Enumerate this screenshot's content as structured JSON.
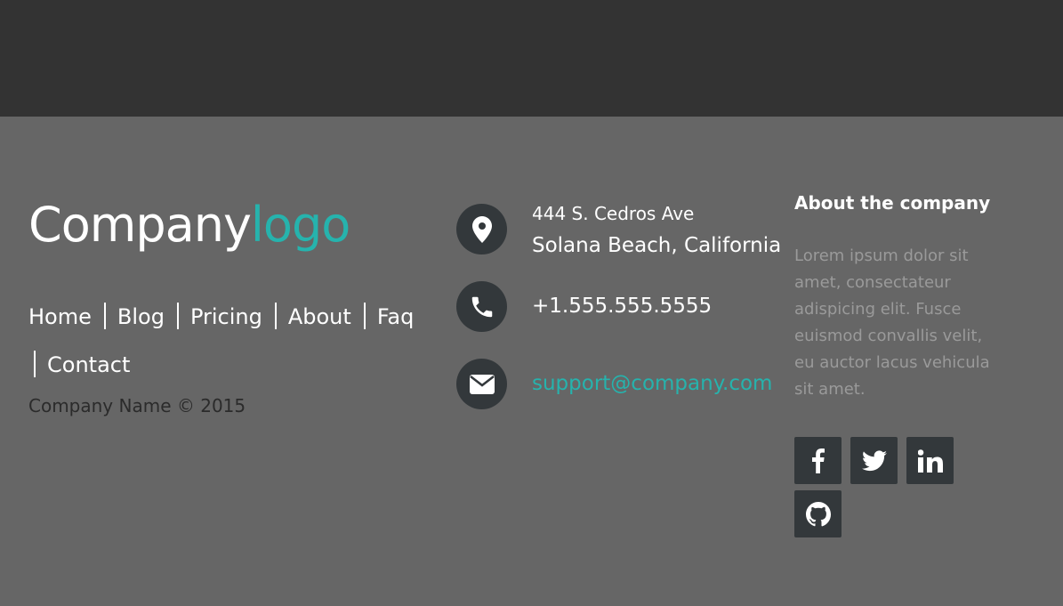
{
  "logo": {
    "part1": "Company",
    "part2": "logo"
  },
  "nav": {
    "items": [
      {
        "label": "Home"
      },
      {
        "label": "Blog"
      },
      {
        "label": "Pricing"
      },
      {
        "label": "About"
      },
      {
        "label": "Faq"
      },
      {
        "label": "Contact"
      }
    ]
  },
  "copyright": "Company Name © 2015",
  "contact": {
    "address_line1": "444 S. Cedros Ave",
    "address_line2": "Solana Beach, California",
    "phone": "+1.555.555.5555",
    "email": "support@company.com"
  },
  "about": {
    "title": "About the company",
    "text": "Lorem ipsum dolor sit amet, consectateur adispicing elit. Fusce euismod convallis velit, eu auctor lacus vehicula sit amet."
  },
  "social": {
    "icons": [
      "facebook-icon",
      "twitter-icon",
      "linkedin-icon",
      "github-icon"
    ]
  },
  "colors": {
    "header_bg": "#333333",
    "footer_bg": "#666666",
    "accent": "#26b3ad",
    "icon_bg": "#33383b"
  }
}
